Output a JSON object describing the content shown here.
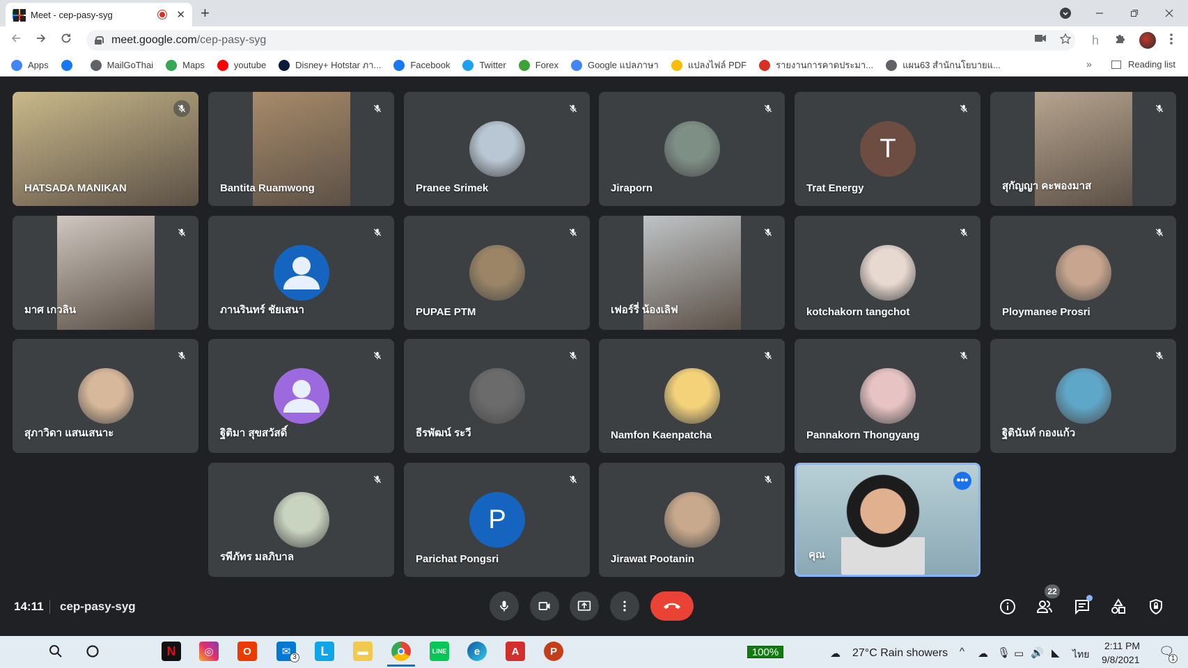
{
  "browser": {
    "tab_title": "Meet - cep-pasy-syg",
    "close_tab": "✕",
    "new_tab": "+",
    "url_host": "meet.google.com",
    "url_path": "/cep-pasy-syg",
    "bookmarks": [
      {
        "label": "Apps",
        "color": "#4285f4"
      },
      {
        "label": "",
        "color": "#1877f2"
      },
      {
        "label": "MailGoThai",
        "color": "#5f6368"
      },
      {
        "label": "Maps",
        "color": "#34a853"
      },
      {
        "label": "youtube",
        "color": "#ff0000"
      },
      {
        "label": "Disney+ Hotstar ภา...",
        "color": "#0a1a3a"
      },
      {
        "label": "Facebook",
        "color": "#1877f2"
      },
      {
        "label": "Twitter",
        "color": "#1da1f2"
      },
      {
        "label": "Forex",
        "color": "#3aa335"
      },
      {
        "label": "Google แปลภาษา",
        "color": "#4285f4"
      },
      {
        "label": "แปลงไฟล์ PDF",
        "color": "#fbbc04"
      },
      {
        "label": "รายงานการคาดประมา...",
        "color": "#d93025"
      },
      {
        "label": "แผน63 สำนักนโยบายแ...",
        "color": "#5f6368"
      }
    ],
    "bookmarks_more": "»",
    "reading_list": "Reading list"
  },
  "meet": {
    "participants": [
      {
        "name": "HATSADA MANIKAN",
        "kind": "video",
        "color": "#c9b98a"
      },
      {
        "name": "Bantita Ruamwong",
        "kind": "video",
        "color": "#a88b6a"
      },
      {
        "name": "Pranee Srimek",
        "kind": "photo",
        "color": "#b9c7d4"
      },
      {
        "name": "Jiraporn",
        "kind": "photo",
        "color": "#7e8f86"
      },
      {
        "name": "Trat Energy",
        "kind": "letter",
        "letter": "T",
        "color": "#6d4c41"
      },
      {
        "name": "สุกัญญา คะพองมาส",
        "kind": "video",
        "color": "#b7a48f"
      },
      {
        "name": "มาศ เกวลิน",
        "kind": "video",
        "color": "#cfc7c0"
      },
      {
        "name": "ภานรินทร์ ชัยเสนา",
        "kind": "default",
        "color": "#1565c0"
      },
      {
        "name": "PUPAE PTM",
        "kind": "photo",
        "color": "#9b8566"
      },
      {
        "name": "เฟอร์รี่ น้องเลิฟ",
        "kind": "video",
        "color": "#bfc3c6"
      },
      {
        "name": "kotchakorn tangchot",
        "kind": "photo",
        "color": "#e8d9d0"
      },
      {
        "name": "Ploymanee Prosri",
        "kind": "photo",
        "color": "#c7a58e"
      },
      {
        "name": "สุภาวิดา แสนเสนาะ",
        "kind": "photo",
        "color": "#d8b89a"
      },
      {
        "name": "ฐิติมา สุขสวัสดิ์",
        "kind": "default",
        "color": "#9c6ade"
      },
      {
        "name": "ธีรพัฒน์ ระวี",
        "kind": "photo",
        "color": "#6b6b6b"
      },
      {
        "name": "Namfon Kaenpatcha",
        "kind": "photo",
        "color": "#f3d27a"
      },
      {
        "name": "Pannakorn Thongyang",
        "kind": "photo",
        "color": "#e8c3c3"
      },
      {
        "name": "ฐิตินันท์ กองแก้ว",
        "kind": "photo",
        "color": "#5fa7c9"
      },
      {
        "name": "รพีภัทร มลภิบาล",
        "kind": "photo",
        "color": "#c9d4c0"
      },
      {
        "name": "Parichat Pongsri",
        "kind": "letter",
        "letter": "P",
        "color": "#1565c0"
      },
      {
        "name": "Jirawat Pootanin",
        "kind": "photo",
        "color": "#c9a98d"
      },
      {
        "name": "คุณ",
        "kind": "self",
        "color": "#b8cfd6"
      }
    ],
    "time": "14:11",
    "meeting_code": "cep-pasy-syg",
    "participant_count": "22",
    "more_options": "•••"
  },
  "taskbar": {
    "battery": "100%",
    "weather": "27°C  Rain showers",
    "language": "ไทย",
    "clock_time": "2:11 PM",
    "clock_date": "9/8/2021",
    "mail_count": "3",
    "notification_count": "1"
  }
}
